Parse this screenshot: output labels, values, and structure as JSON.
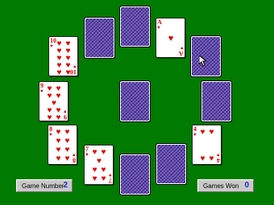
{
  "status": {
    "game_number_label": "Game Number",
    "game_number_value": "2",
    "games_won_label": "Games Won",
    "games_won_value": "0"
  },
  "cards": {
    "ten_rank": "10",
    "ace_rank": "A",
    "nine_rank": "9",
    "eight_rank": "8",
    "seven_rank": "7",
    "four_rank": "4",
    "heart": "♥"
  },
  "colors": {
    "table_green": "#007a00",
    "card_back": "#2a2fa6",
    "heart_red": "#e00000",
    "counter_blue": "#1a2ccf"
  }
}
